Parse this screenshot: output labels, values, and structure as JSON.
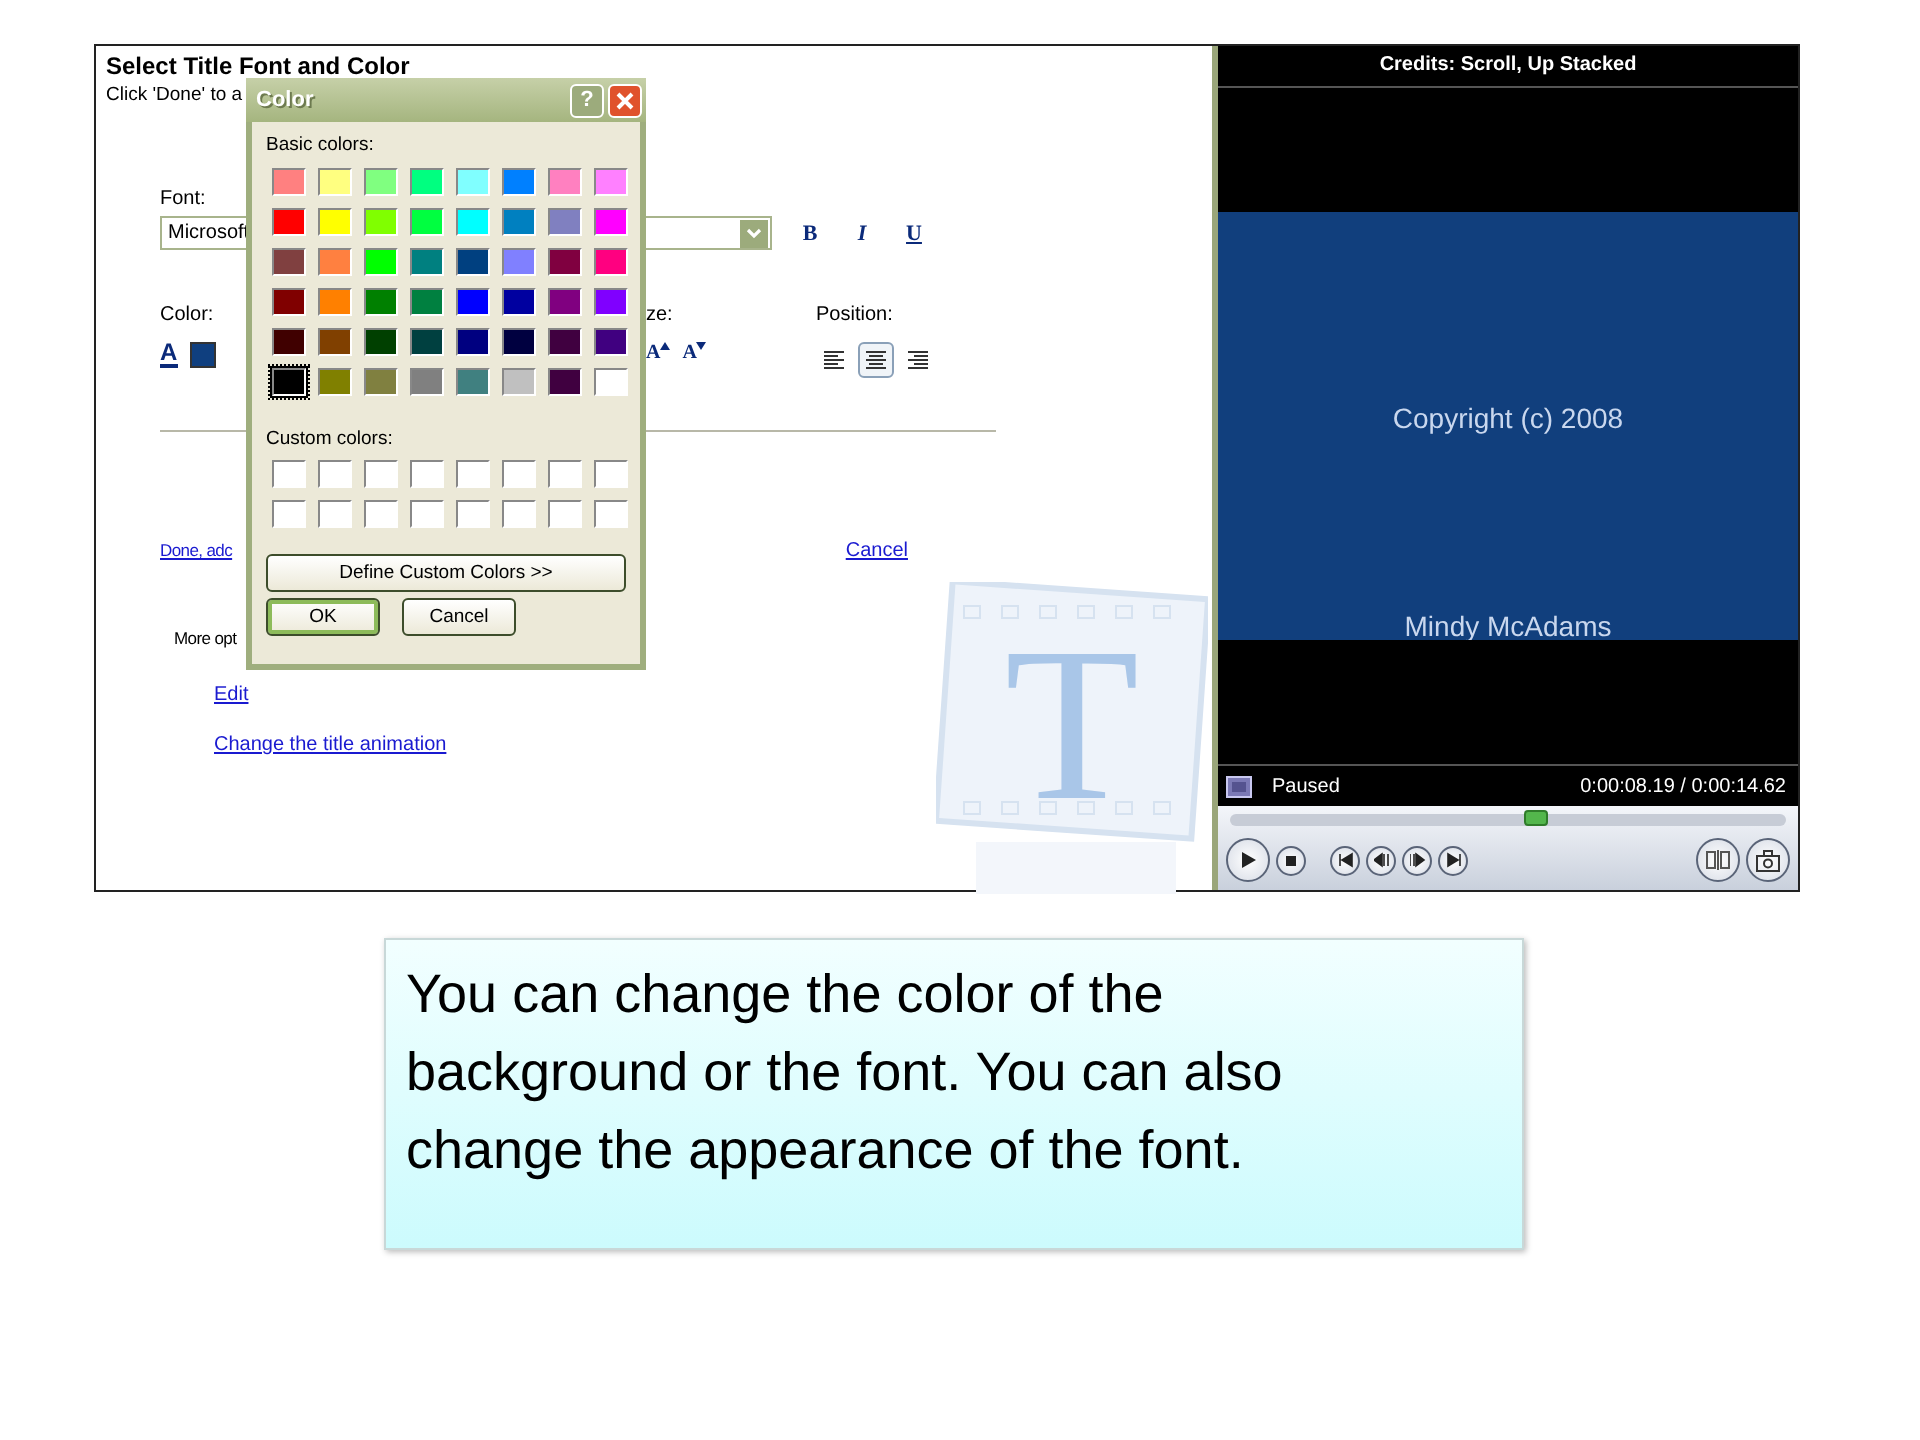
{
  "editor": {
    "title": "Select Title Font and Color",
    "subtitle": "Click 'Done' to a",
    "font_label": "Font:",
    "font_value": "Microsoft",
    "style_buttons": [
      "B",
      "I",
      "U"
    ],
    "color_label": "Color:",
    "font_color_glyph": "A",
    "size_label": "ze:",
    "size_buttons": [
      "A",
      "A"
    ],
    "position_label": "Position:",
    "alignments": [
      {
        "kind": "left",
        "selected": false
      },
      {
        "kind": "center",
        "selected": true
      },
      {
        "kind": "right",
        "selected": false
      }
    ],
    "done_link": "Done, adc",
    "cancel_link": "Cancel",
    "more_options": "More opt",
    "edit_link": "Edit",
    "animation_link": "Change the title animation",
    "logo_letter": "T"
  },
  "color_dialog": {
    "title": "Color",
    "help": "?",
    "basic_label": "Basic colors:",
    "swatches": [
      {
        "color": "#ff8080",
        "selected": false
      },
      {
        "color": "#ffff80",
        "selected": false
      },
      {
        "color": "#80ff80",
        "selected": false
      },
      {
        "color": "#00ff80",
        "selected": false
      },
      {
        "color": "#80ffff",
        "selected": false
      },
      {
        "color": "#0080ff",
        "selected": false
      },
      {
        "color": "#ff80c0",
        "selected": false
      },
      {
        "color": "#ff80ff",
        "selected": false
      },
      {
        "color": "#ff0000",
        "selected": false
      },
      {
        "color": "#ffff00",
        "selected": false
      },
      {
        "color": "#80ff00",
        "selected": false
      },
      {
        "color": "#00ff40",
        "selected": false
      },
      {
        "color": "#00ffff",
        "selected": false
      },
      {
        "color": "#0080c0",
        "selected": false
      },
      {
        "color": "#8080c0",
        "selected": false
      },
      {
        "color": "#ff00ff",
        "selected": false
      },
      {
        "color": "#804040",
        "selected": false
      },
      {
        "color": "#ff8040",
        "selected": false
      },
      {
        "color": "#00ff00",
        "selected": false
      },
      {
        "color": "#008080",
        "selected": false
      },
      {
        "color": "#004080",
        "selected": false
      },
      {
        "color": "#8080ff",
        "selected": false
      },
      {
        "color": "#800040",
        "selected": false
      },
      {
        "color": "#ff0080",
        "selected": false
      },
      {
        "color": "#800000",
        "selected": false
      },
      {
        "color": "#ff8000",
        "selected": false
      },
      {
        "color": "#008000",
        "selected": false
      },
      {
        "color": "#008040",
        "selected": false
      },
      {
        "color": "#0000ff",
        "selected": false
      },
      {
        "color": "#0000a0",
        "selected": false
      },
      {
        "color": "#800080",
        "selected": false
      },
      {
        "color": "#8000ff",
        "selected": false
      },
      {
        "color": "#400000",
        "selected": false
      },
      {
        "color": "#804000",
        "selected": false
      },
      {
        "color": "#004000",
        "selected": false
      },
      {
        "color": "#004040",
        "selected": false
      },
      {
        "color": "#000080",
        "selected": false
      },
      {
        "color": "#000040",
        "selected": false
      },
      {
        "color": "#400040",
        "selected": false
      },
      {
        "color": "#400080",
        "selected": false
      },
      {
        "color": "#000000",
        "selected": true
      },
      {
        "color": "#808000",
        "selected": false
      },
      {
        "color": "#808040",
        "selected": false
      },
      {
        "color": "#808080",
        "selected": false
      },
      {
        "color": "#408080",
        "selected": false
      },
      {
        "color": "#c0c0c0",
        "selected": false
      },
      {
        "color": "#400040",
        "selected": false
      },
      {
        "color": "#ffffff",
        "selected": false
      }
    ],
    "custom_label": "Custom colors:",
    "define_button": "Define Custom Colors >>",
    "ok_button": "OK",
    "cancel_button": "Cancel"
  },
  "preview": {
    "title": "Credits: Scroll, Up Stacked",
    "lines": [
      "Copyright (c) 2008",
      "Mindy McAdams"
    ],
    "status": "Paused",
    "time": "0:00:08.19 / 0:00:14.62",
    "seek": {
      "level": 0.55
    }
  },
  "caption": "You can change the color of the background or the font. You can also change the appearance of the font."
}
